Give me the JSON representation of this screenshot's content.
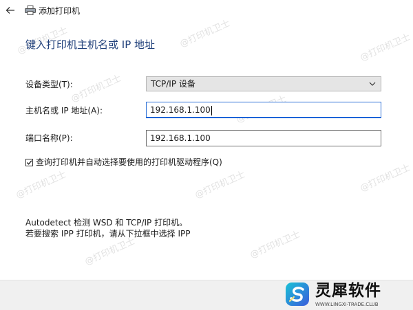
{
  "window": {
    "title": "添加打印机"
  },
  "page": {
    "heading": "键入打印机主机名或 IP 地址"
  },
  "form": {
    "device_type": {
      "label": "设备类型(T):",
      "value": "TCP/IP 设备"
    },
    "hostname": {
      "label": "主机名或 IP 地址(A):",
      "value": "192.168.1.100"
    },
    "port_name": {
      "label": "端口名称(P):",
      "value": "192.168.1.100"
    },
    "query_checkbox": {
      "label": "查询打印机并自动选择要使用的打印机驱动程序(Q)",
      "checked": true
    }
  },
  "info": {
    "line1": "Autodetect 检测 WSD 和 TCP/IP 打印机。",
    "line2": "若要搜索 IPP 打印机，请从下拉框中选择 IPP"
  },
  "watermark": {
    "text": "@打印机卫士"
  },
  "brand": {
    "name": "灵犀软件",
    "url": "WWW.LINGXI-TRADE.CLUB"
  },
  "icons": {
    "back": "back-arrow-icon",
    "printer": "printer-icon",
    "dropdown": "chevron-down-icon",
    "check": "checkmark-icon",
    "brand": "brand-logo-icon"
  },
  "colors": {
    "heading": "#1f3f7a",
    "focus_border": "#1463d8",
    "select_bg": "#e5e5e5",
    "footer_bg": "#f0f0f0"
  }
}
